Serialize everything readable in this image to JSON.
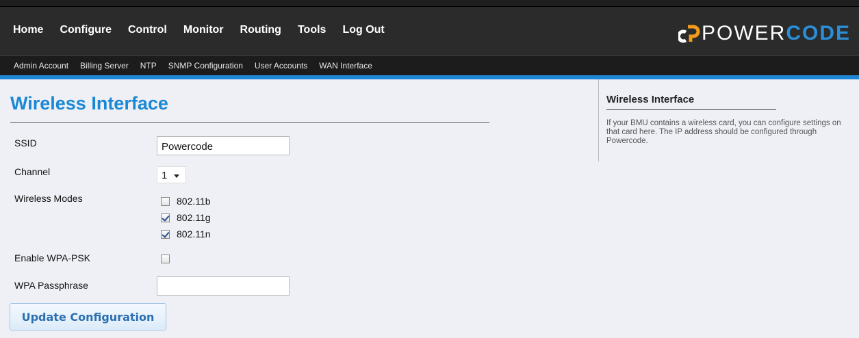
{
  "nav": {
    "items": [
      "Home",
      "Configure",
      "Control",
      "Monitor",
      "Routing",
      "Tools",
      "Log Out"
    ]
  },
  "logo": {
    "part1": "POWER",
    "part2": "CODE",
    "accent": "#2a8fd8"
  },
  "subnav": {
    "items": [
      "Admin Account",
      "Billing Server",
      "NTP",
      "SNMP Configuration",
      "User Accounts",
      "WAN Interface"
    ]
  },
  "page": {
    "title": "Wireless Interface"
  },
  "form": {
    "ssid_label": "SSID",
    "ssid_value": "Powercode",
    "channel_label": "Channel",
    "channel_value": "1",
    "modes_label": "Wireless Modes",
    "modes": [
      {
        "label": "802.11b",
        "checked": false
      },
      {
        "label": "802.11g",
        "checked": true
      },
      {
        "label": "802.11n",
        "checked": true
      }
    ],
    "wpa_label": "Enable WPA-PSK",
    "wpa_checked": false,
    "passphrase_label": "WPA Passphrase",
    "passphrase_value": "",
    "submit_label": "Update Configuration"
  },
  "help": {
    "title": "Wireless Interface",
    "text": "If your BMU contains a wireless card, you can configure settings on that card here. The IP address should be configured through Powercode."
  },
  "colors": {
    "accent_bar": "#1f86d6",
    "title": "#1b88d5"
  }
}
